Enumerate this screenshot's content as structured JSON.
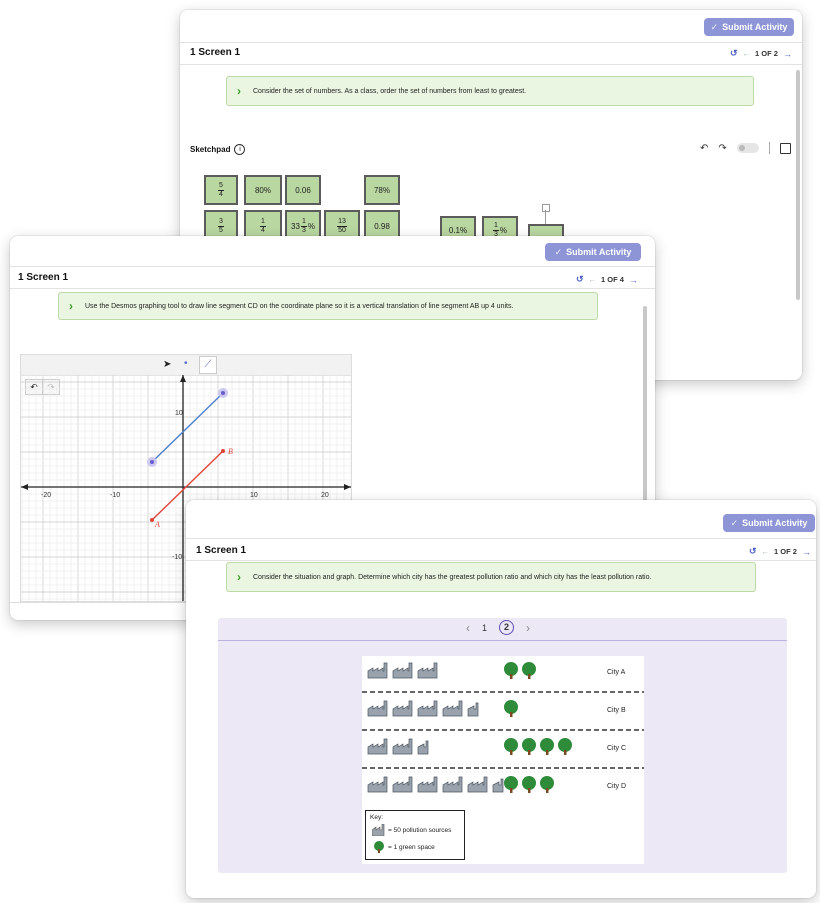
{
  "cards": {
    "top": {
      "submit_label": "Submit Activity",
      "screen_title": "1  Screen 1",
      "page_indicator": "1 OF 2",
      "prompt": "Consider the set of numbers. As a class, order the set of numbers from least to greatest.",
      "sketchpad_label": "Sketchpad",
      "tiles": [
        "80%",
        "0.06",
        "78%",
        "0.98",
        "0.1%"
      ],
      "fracs": {
        "f54n": "5",
        "f54d": "4",
        "f35n": "3",
        "f35d": "5",
        "f14n": "1",
        "f14d": "4",
        "f1350n": "13",
        "f1350d": "50",
        "f13pn": "1",
        "f13pd": "3"
      },
      "mixed": {
        "whole": "33",
        "num": "1",
        "den": "3",
        "pct": "%"
      }
    },
    "middle": {
      "submit_label": "Submit Activity",
      "screen_title": "1  Screen 1",
      "page_indicator": "1 OF 4",
      "prompt": "Use the Desmos graphing tool to draw line segment CD on the coordinate plane so it is a vertical translation of line segment AB up 4 units.",
      "graph": {
        "x_ticks": [
          "-20",
          "-10",
          "10",
          "20"
        ],
        "y_ticks": [
          "10",
          "-10"
        ],
        "point_a": "A",
        "point_b": "B",
        "segment_ab_color": "#e04438",
        "segment_cd_color": "#4a7fcf"
      }
    },
    "bottom": {
      "submit_label": "Submit Activity",
      "screen_title": "1  Screen 1",
      "page_indicator": "1 OF 2",
      "prompt": "Consider the situation and graph. Determine which city has the greatest pollution ratio and which city has the least pollution ratio.",
      "pager": {
        "prev": "‹",
        "p1": "1",
        "p2": "2",
        "next": "›"
      },
      "chart_data": {
        "type": "pictograph",
        "categories": [
          "City A",
          "City B",
          "City C",
          "City D"
        ],
        "series": [
          {
            "name": "pollution sources",
            "values": [
              3,
              4.5,
              2.5,
              5.5
            ]
          },
          {
            "name": "green space",
            "values": [
              2,
              1,
              4,
              3
            ]
          }
        ]
      },
      "key": {
        "title": "Key:",
        "factory_text": "= 50 pollution sources",
        "tree_text": "= 1 green space"
      }
    }
  },
  "colors": {
    "accent": "#8e95d6",
    "prompt_bg": "#eaf6e1",
    "link": "#4c5fc7",
    "panel": "#ece8f5"
  }
}
